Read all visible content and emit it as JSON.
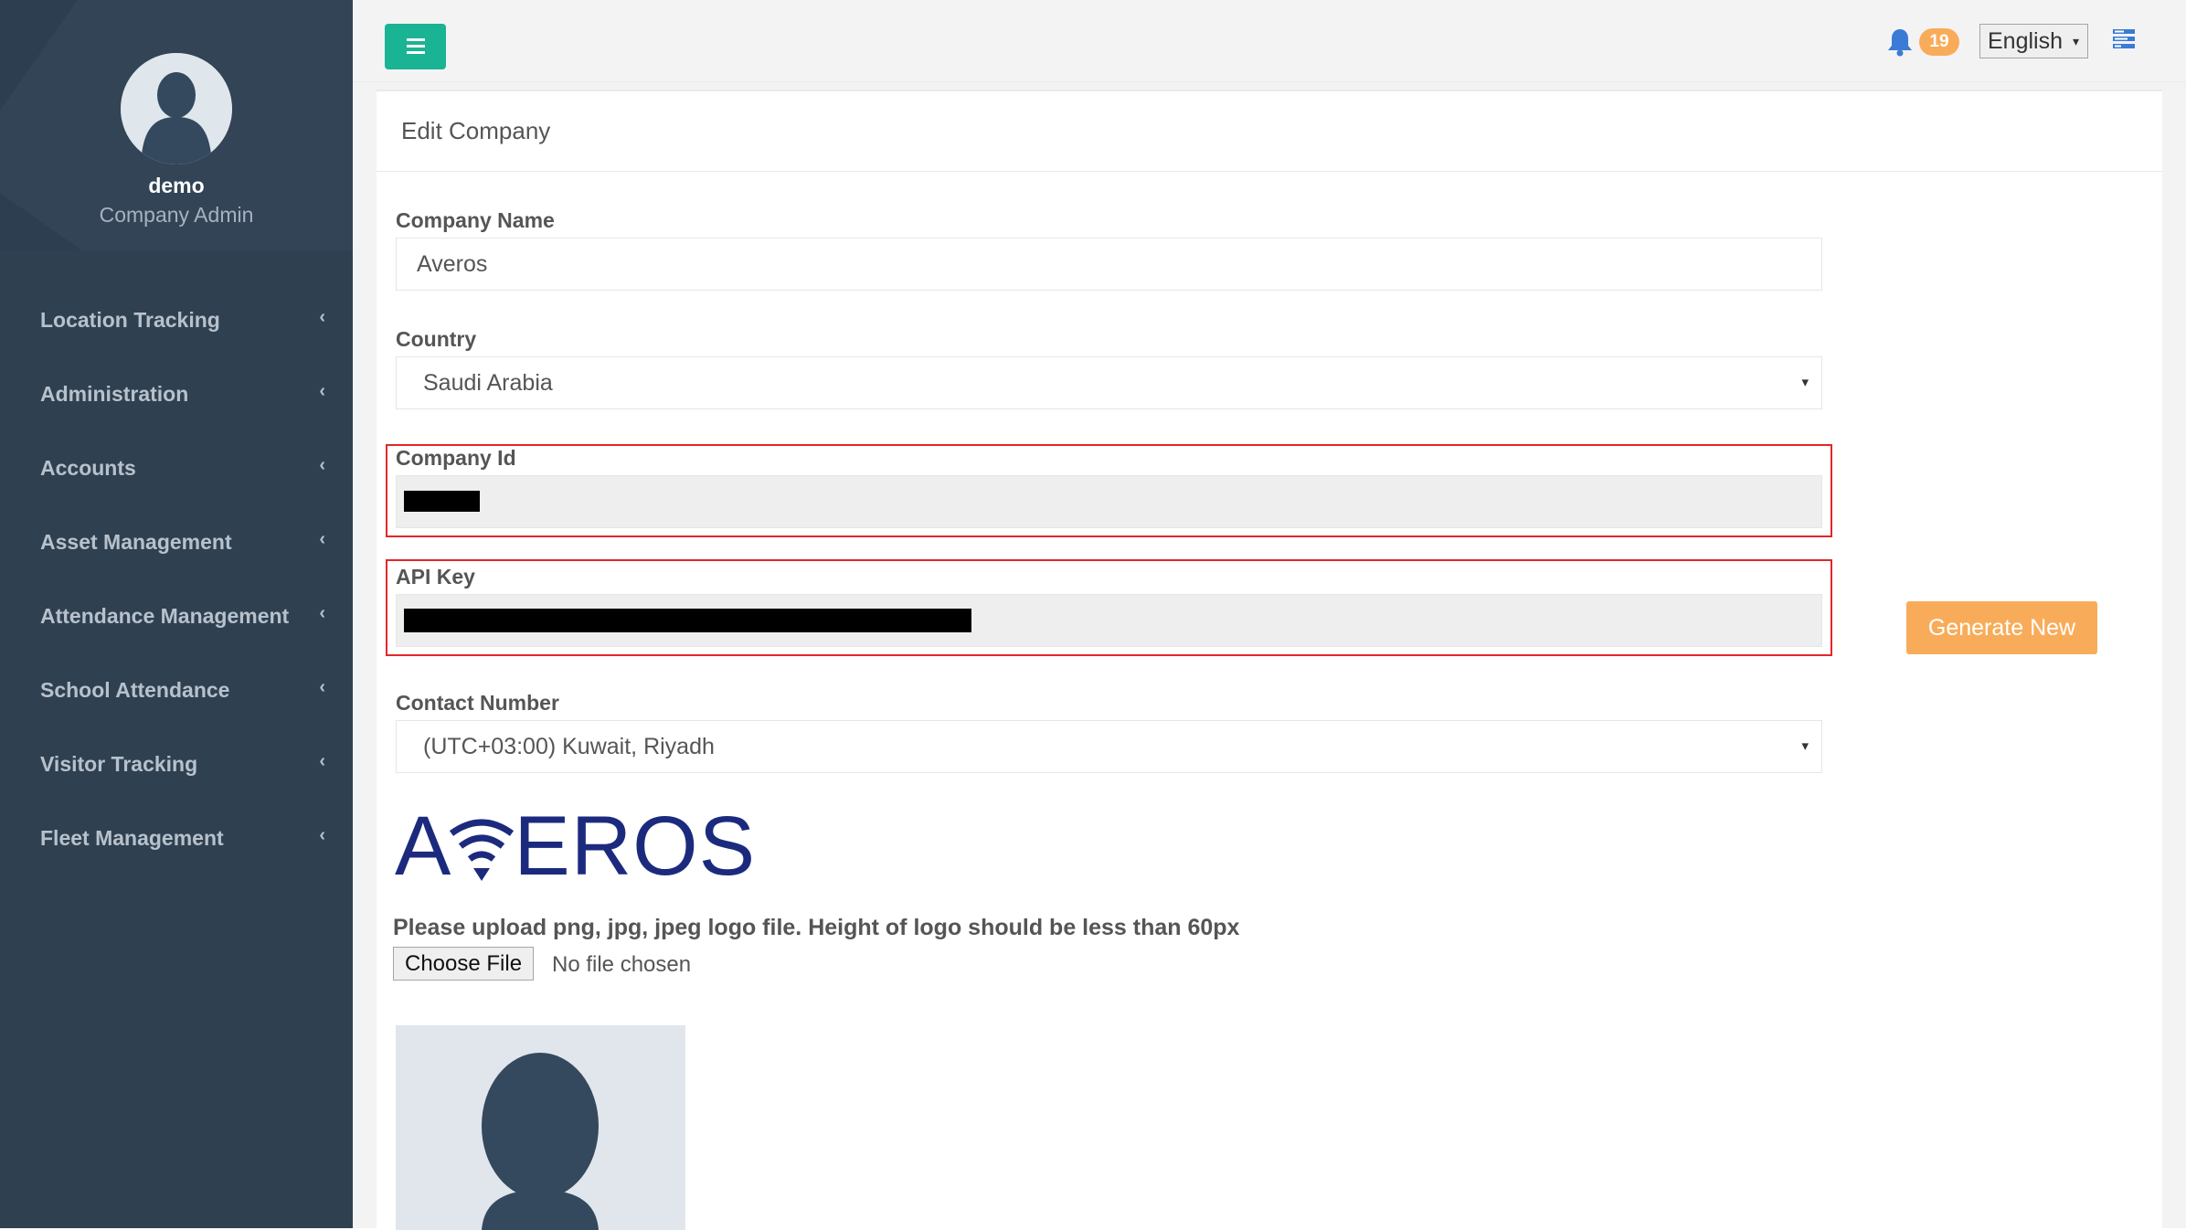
{
  "profile": {
    "name": "demo",
    "role": "Company Admin"
  },
  "sidebar": {
    "items": [
      {
        "label": "Location Tracking"
      },
      {
        "label": "Administration"
      },
      {
        "label": "Accounts"
      },
      {
        "label": "Asset Management"
      },
      {
        "label": "Attendance Management"
      },
      {
        "label": "School Attendance"
      },
      {
        "label": "Visitor Tracking"
      },
      {
        "label": "Fleet Management"
      }
    ],
    "chevron": "‹"
  },
  "topbar": {
    "notification_count": "19",
    "language": "English",
    "caret": "▾"
  },
  "page": {
    "title": "Edit Company"
  },
  "form": {
    "company_name": {
      "label": "Company Name",
      "value": "Averos"
    },
    "country": {
      "label": "Country",
      "value": "Saudi Arabia"
    },
    "company_id": {
      "label": "Company Id"
    },
    "api_key": {
      "label": "API Key"
    },
    "generate_new_label": "Generate New",
    "contact_number": {
      "label": "Contact Number",
      "value": "(UTC+03:00) Kuwait, Riyadh"
    },
    "logo_text": {
      "first": "A",
      "rest": "EROS"
    },
    "upload_note": "Please upload png, jpg, jpeg logo file. Height of logo should be less than 60px",
    "choose_file_label": "Choose File",
    "file_status": "No file chosen"
  },
  "colors": {
    "sidebar_bg": "#2f4050",
    "accent_green": "#1ab394",
    "accent_orange": "#f8ac59",
    "highlight_red": "#e3262a",
    "logo_navy": "#1c2a7e"
  }
}
